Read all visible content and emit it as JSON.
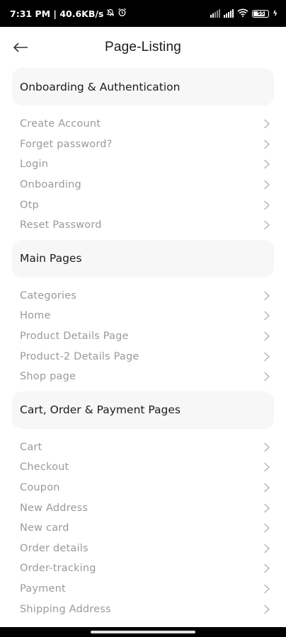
{
  "status_bar": {
    "time_info": "7:31 PM | 40.6KB/s",
    "battery": "55"
  },
  "header": {
    "title": "Page-Listing"
  },
  "sections": [
    {
      "title": "Onboarding & Authentication",
      "items": [
        "Create Account",
        "Forget password?",
        "Login",
        "Onboarding",
        "Otp",
        "Reset Password"
      ]
    },
    {
      "title": "Main Pages",
      "items": [
        "Categories",
        "Home",
        "Product Details Page",
        "Product-2 Details Page",
        "Shop page"
      ]
    },
    {
      "title": "Cart, Order & Payment Pages",
      "items": [
        "Cart",
        "Checkout",
        "Coupon",
        "New Address",
        "New card",
        "Order details",
        "Order-tracking",
        "Payment",
        "Shipping Address"
      ]
    }
  ],
  "icons": {
    "back": "arrow-left-icon",
    "chevron": "chevron-right-icon",
    "mute": "bell-off-icon",
    "alarm": "alarm-icon",
    "signal": "signal-icon",
    "wifi": "wifi-icon",
    "battery": "battery-icon"
  },
  "colors": {
    "card_bg": "#f7f7f7",
    "item_text": "#9a9a9a",
    "title_text": "#1a1a1a"
  }
}
